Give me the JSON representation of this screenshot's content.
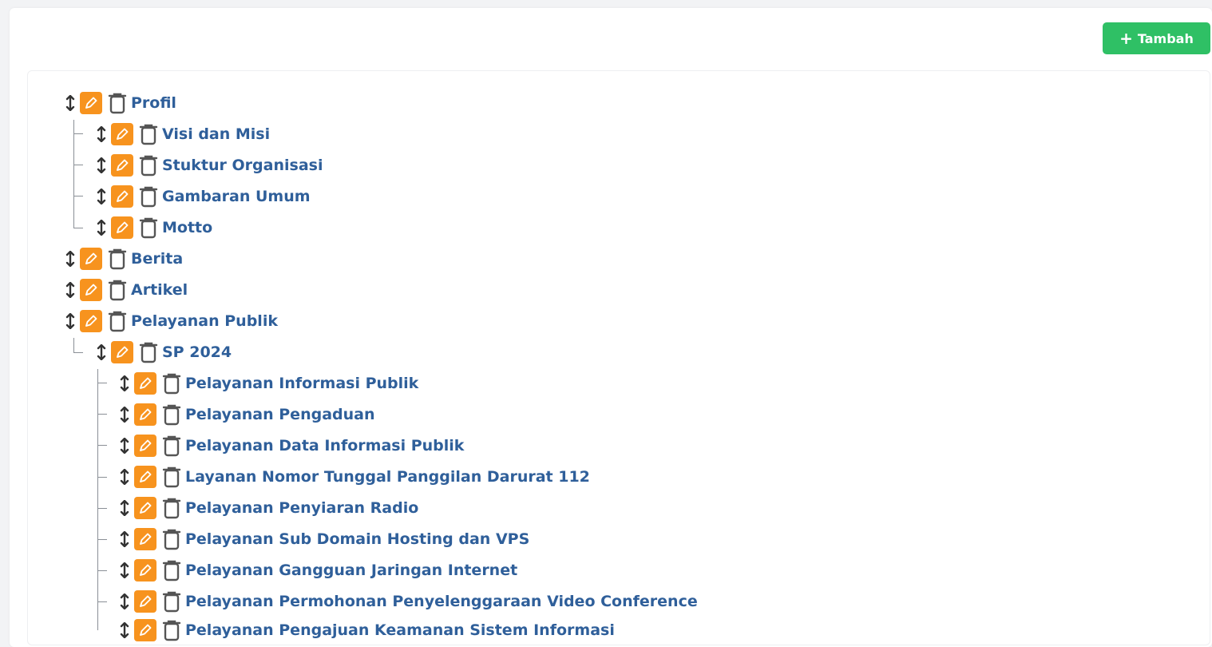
{
  "toolbar": {
    "add_label": "Tambah",
    "add_icon": "plus-icon"
  },
  "colors": {
    "accent_green": "#2fc065",
    "edit_orange": "#f7931e",
    "link_blue": "#2f5f9a",
    "guide_gray": "#8a8f96"
  },
  "icons": {
    "drag": "drag-handle-icon",
    "edit": "pencil-icon",
    "delete": "trash-icon"
  },
  "menu": {
    "items": [
      {
        "label": "Profil"
      },
      {
        "label": "Visi dan Misi"
      },
      {
        "label": "Stuktur Organisasi"
      },
      {
        "label": "Gambaran Umum"
      },
      {
        "label": "Motto"
      },
      {
        "label": "Berita"
      },
      {
        "label": "Artikel"
      },
      {
        "label": "Pelayanan Publik"
      },
      {
        "label": "SP 2024"
      },
      {
        "label": "Pelayanan Informasi Publik"
      },
      {
        "label": "Pelayanan Pengaduan"
      },
      {
        "label": "Pelayanan Data Informasi Publik"
      },
      {
        "label": "Layanan Nomor Tunggal Panggilan Darurat 112"
      },
      {
        "label": "Pelayanan Penyiaran Radio"
      },
      {
        "label": "Pelayanan Sub Domain Hosting dan VPS"
      },
      {
        "label": "Pelayanan Gangguan Jaringan Internet"
      },
      {
        "label": "Pelayanan Permohonan Penyelenggaraan Video Conference"
      },
      {
        "label": "Pelayanan Pengajuan Keamanan Sistem Informasi"
      }
    ]
  }
}
